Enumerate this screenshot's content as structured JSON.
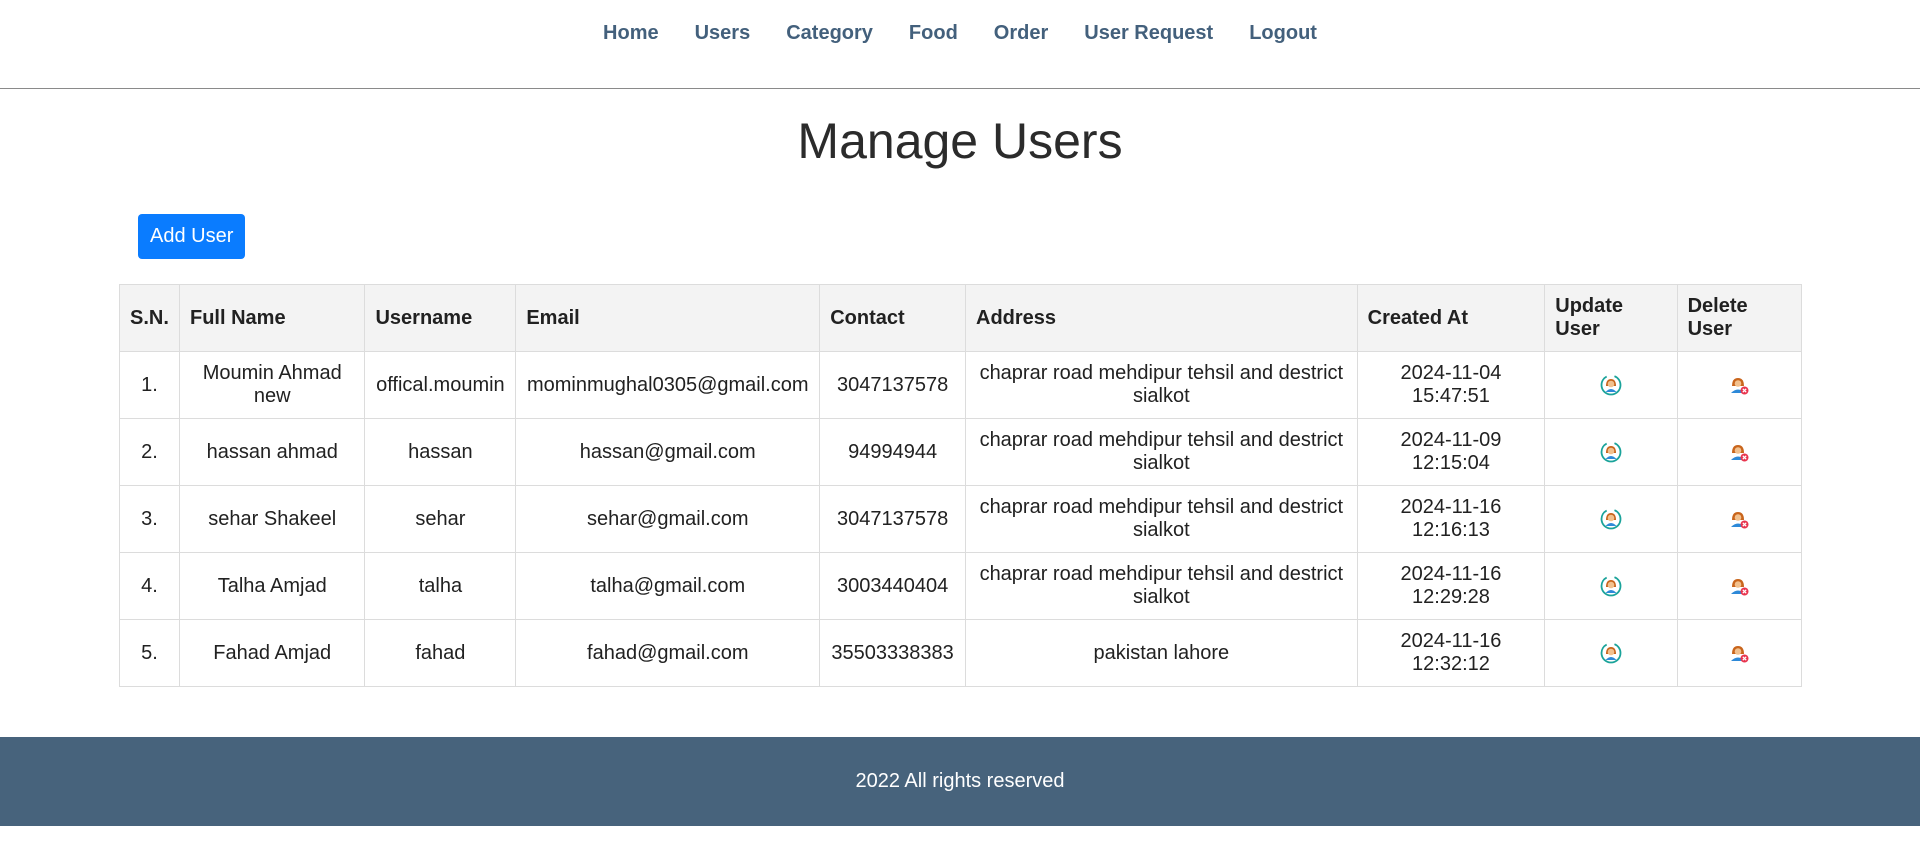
{
  "nav": {
    "items": [
      {
        "label": "Home"
      },
      {
        "label": "Users"
      },
      {
        "label": "Category"
      },
      {
        "label": "Food"
      },
      {
        "label": "Order"
      },
      {
        "label": "User Request"
      },
      {
        "label": "Logout"
      }
    ]
  },
  "page": {
    "title": "Manage Users",
    "add_button_label": "Add User"
  },
  "table": {
    "headers": [
      "S.N.",
      "Full Name",
      "Username",
      "Email",
      "Contact",
      "Address",
      "Created At",
      "Update User",
      "Delete User"
    ],
    "update_icon": "user-update-icon",
    "delete_icon": "user-delete-icon",
    "rows": [
      {
        "sn": "1.",
        "full_name": "Moumin Ahmad new",
        "username": "offical.moumin",
        "email": "mominmughal0305@gmail.com",
        "contact": "3047137578",
        "address": "chaprar road mehdipur tehsil and destrict sialkot",
        "created_at": "2024-11-04 15:47:51"
      },
      {
        "sn": "2.",
        "full_name": "hassan ahmad",
        "username": "hassan",
        "email": "hassan@gmail.com",
        "contact": "94994944",
        "address": "chaprar road mehdipur tehsil and destrict sialkot",
        "created_at": "2024-11-09 12:15:04"
      },
      {
        "sn": "3.",
        "full_name": "sehar Shakeel",
        "username": "sehar",
        "email": "sehar@gmail.com",
        "contact": "3047137578",
        "address": "chaprar road mehdipur tehsil and destrict sialkot",
        "created_at": "2024-11-16 12:16:13"
      },
      {
        "sn": "4.",
        "full_name": "Talha Amjad",
        "username": "talha",
        "email": "talha@gmail.com",
        "contact": "3003440404",
        "address": "chaprar road mehdipur tehsil and destrict sialkot",
        "created_at": "2024-11-16 12:29:28"
      },
      {
        "sn": "5.",
        "full_name": "Fahad Amjad",
        "username": "fahad",
        "email": "fahad@gmail.com",
        "contact": "35503338383",
        "address": "pakistan lahore",
        "created_at": "2024-11-16 12:32:12"
      }
    ]
  },
  "footer": {
    "text": "2022 All rights reserved"
  },
  "colors": {
    "nav_link": "#43607c",
    "button": "#0a7cff",
    "footer_bg": "#47637c",
    "header_bg": "#f3f3f3"
  }
}
